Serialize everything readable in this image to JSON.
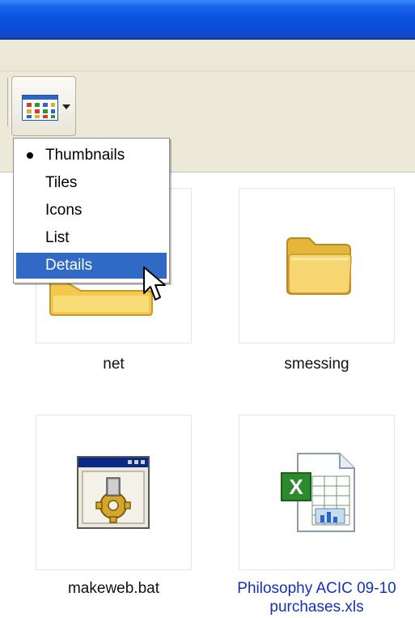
{
  "views_menu": {
    "items": [
      {
        "label": "Thumbnails",
        "checked": true,
        "highlighted": false
      },
      {
        "label": "Tiles",
        "checked": false,
        "highlighted": false
      },
      {
        "label": "Icons",
        "checked": false,
        "highlighted": false
      },
      {
        "label": "List",
        "checked": false,
        "highlighted": false
      },
      {
        "label": "Details",
        "checked": false,
        "highlighted": true
      }
    ]
  },
  "files": [
    {
      "name": "net",
      "icon": "folder-icon",
      "selected": false
    },
    {
      "name": "smessing",
      "icon": "folder-icon",
      "selected": false
    },
    {
      "name": "makeweb.bat",
      "icon": "batch-file-icon",
      "selected": false
    },
    {
      "name_line1": "Philosophy ACIC  09-10",
      "name_line2": "purchases.xls",
      "icon": "excel-file-icon",
      "selected": false
    }
  ],
  "toolbar": {
    "views_button_icon": "views-icon",
    "views_dropdown_icon": "chevron-down-icon"
  },
  "colors": {
    "title_bar": "#0a52e0",
    "menu_highlight": "#316ac5",
    "chrome": "#ece9d8",
    "xls_label": "#1530b8"
  }
}
